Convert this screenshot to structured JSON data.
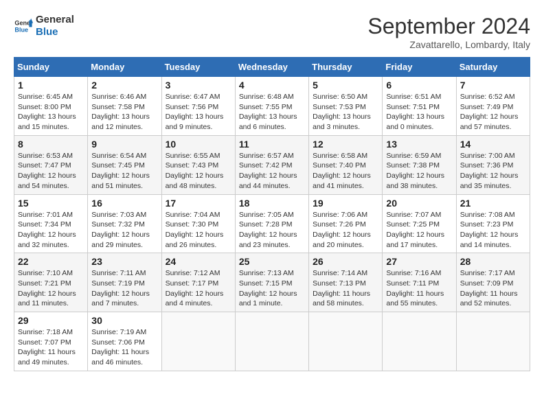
{
  "logo": {
    "line1": "General",
    "line2": "Blue"
  },
  "title": "September 2024",
  "subtitle": "Zavattarello, Lombardy, Italy",
  "weekdays": [
    "Sunday",
    "Monday",
    "Tuesday",
    "Wednesday",
    "Thursday",
    "Friday",
    "Saturday"
  ],
  "weeks": [
    [
      {
        "day": "1",
        "sunrise": "6:45 AM",
        "sunset": "8:00 PM",
        "daylight": "13 hours and 15 minutes."
      },
      {
        "day": "2",
        "sunrise": "6:46 AM",
        "sunset": "7:58 PM",
        "daylight": "13 hours and 12 minutes."
      },
      {
        "day": "3",
        "sunrise": "6:47 AM",
        "sunset": "7:56 PM",
        "daylight": "13 hours and 9 minutes."
      },
      {
        "day": "4",
        "sunrise": "6:48 AM",
        "sunset": "7:55 PM",
        "daylight": "13 hours and 6 minutes."
      },
      {
        "day": "5",
        "sunrise": "6:50 AM",
        "sunset": "7:53 PM",
        "daylight": "13 hours and 3 minutes."
      },
      {
        "day": "6",
        "sunrise": "6:51 AM",
        "sunset": "7:51 PM",
        "daylight": "13 hours and 0 minutes."
      },
      {
        "day": "7",
        "sunrise": "6:52 AM",
        "sunset": "7:49 PM",
        "daylight": "12 hours and 57 minutes."
      }
    ],
    [
      {
        "day": "8",
        "sunrise": "6:53 AM",
        "sunset": "7:47 PM",
        "daylight": "12 hours and 54 minutes."
      },
      {
        "day": "9",
        "sunrise": "6:54 AM",
        "sunset": "7:45 PM",
        "daylight": "12 hours and 51 minutes."
      },
      {
        "day": "10",
        "sunrise": "6:55 AM",
        "sunset": "7:43 PM",
        "daylight": "12 hours and 48 minutes."
      },
      {
        "day": "11",
        "sunrise": "6:57 AM",
        "sunset": "7:42 PM",
        "daylight": "12 hours and 44 minutes."
      },
      {
        "day": "12",
        "sunrise": "6:58 AM",
        "sunset": "7:40 PM",
        "daylight": "12 hours and 41 minutes."
      },
      {
        "day": "13",
        "sunrise": "6:59 AM",
        "sunset": "7:38 PM",
        "daylight": "12 hours and 38 minutes."
      },
      {
        "day": "14",
        "sunrise": "7:00 AM",
        "sunset": "7:36 PM",
        "daylight": "12 hours and 35 minutes."
      }
    ],
    [
      {
        "day": "15",
        "sunrise": "7:01 AM",
        "sunset": "7:34 PM",
        "daylight": "12 hours and 32 minutes."
      },
      {
        "day": "16",
        "sunrise": "7:03 AM",
        "sunset": "7:32 PM",
        "daylight": "12 hours and 29 minutes."
      },
      {
        "day": "17",
        "sunrise": "7:04 AM",
        "sunset": "7:30 PM",
        "daylight": "12 hours and 26 minutes."
      },
      {
        "day": "18",
        "sunrise": "7:05 AM",
        "sunset": "7:28 PM",
        "daylight": "12 hours and 23 minutes."
      },
      {
        "day": "19",
        "sunrise": "7:06 AM",
        "sunset": "7:26 PM",
        "daylight": "12 hours and 20 minutes."
      },
      {
        "day": "20",
        "sunrise": "7:07 AM",
        "sunset": "7:25 PM",
        "daylight": "12 hours and 17 minutes."
      },
      {
        "day": "21",
        "sunrise": "7:08 AM",
        "sunset": "7:23 PM",
        "daylight": "12 hours and 14 minutes."
      }
    ],
    [
      {
        "day": "22",
        "sunrise": "7:10 AM",
        "sunset": "7:21 PM",
        "daylight": "12 hours and 11 minutes."
      },
      {
        "day": "23",
        "sunrise": "7:11 AM",
        "sunset": "7:19 PM",
        "daylight": "12 hours and 7 minutes."
      },
      {
        "day": "24",
        "sunrise": "7:12 AM",
        "sunset": "7:17 PM",
        "daylight": "12 hours and 4 minutes."
      },
      {
        "day": "25",
        "sunrise": "7:13 AM",
        "sunset": "7:15 PM",
        "daylight": "12 hours and 1 minute."
      },
      {
        "day": "26",
        "sunrise": "7:14 AM",
        "sunset": "7:13 PM",
        "daylight": "11 hours and 58 minutes."
      },
      {
        "day": "27",
        "sunrise": "7:16 AM",
        "sunset": "7:11 PM",
        "daylight": "11 hours and 55 minutes."
      },
      {
        "day": "28",
        "sunrise": "7:17 AM",
        "sunset": "7:09 PM",
        "daylight": "11 hours and 52 minutes."
      }
    ],
    [
      {
        "day": "29",
        "sunrise": "7:18 AM",
        "sunset": "7:07 PM",
        "daylight": "11 hours and 49 minutes."
      },
      {
        "day": "30",
        "sunrise": "7:19 AM",
        "sunset": "7:06 PM",
        "daylight": "11 hours and 46 minutes."
      },
      null,
      null,
      null,
      null,
      null
    ]
  ]
}
